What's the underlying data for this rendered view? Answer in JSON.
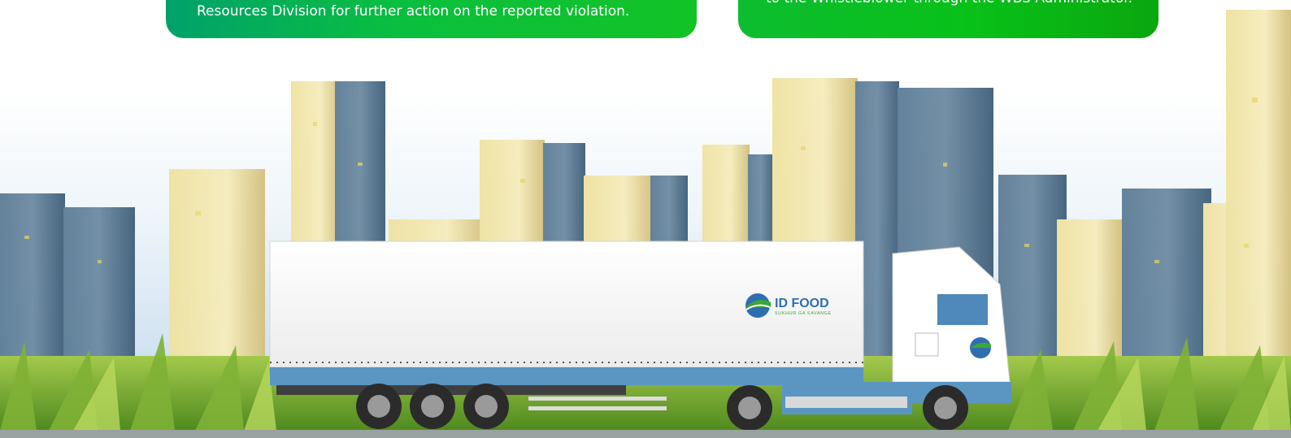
{
  "cards": {
    "left": {
      "text": "Resources Division for further action on the reported violation."
    },
    "right": {
      "text": "to the Whistleblower through the WBS Administrator."
    }
  },
  "truck": {
    "logo_text": "ID FOOD",
    "logo_tagline": "SUKHUR GA SAVANGE"
  },
  "colors": {
    "card_green": "#0abf3e",
    "card_teal": "#00a26b",
    "brand_blue": "#2f6fb0",
    "brand_green": "#3aa832",
    "grass": "#6aa52a"
  }
}
